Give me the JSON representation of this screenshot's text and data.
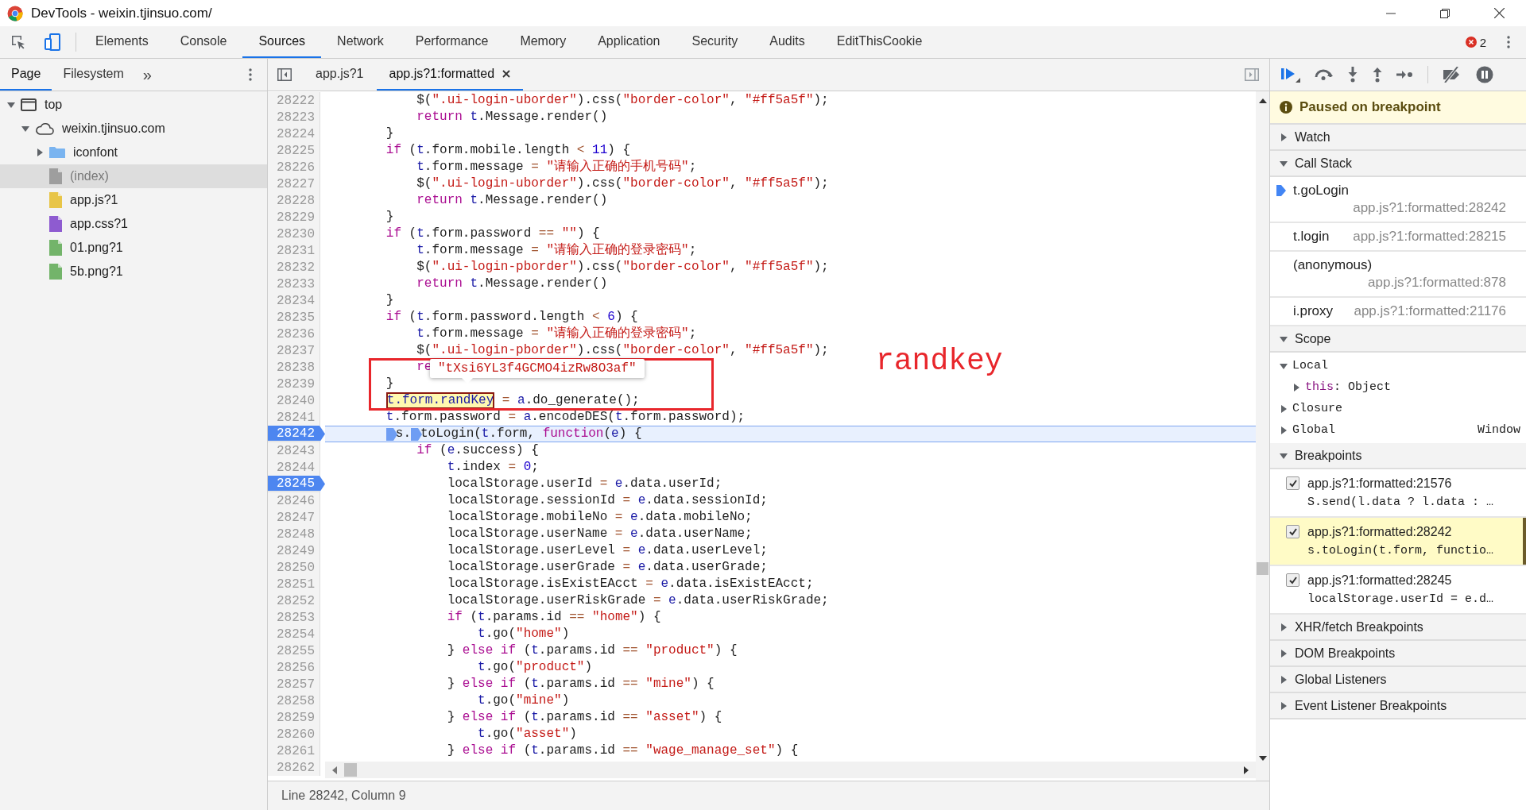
{
  "window": {
    "title": "DevTools - weixin.tjinsuo.com/"
  },
  "main_tabs": [
    {
      "label": "Elements",
      "selected": false
    },
    {
      "label": "Console",
      "selected": false
    },
    {
      "label": "Sources",
      "selected": true
    },
    {
      "label": "Network",
      "selected": false
    },
    {
      "label": "Performance",
      "selected": false
    },
    {
      "label": "Memory",
      "selected": false
    },
    {
      "label": "Application",
      "selected": false
    },
    {
      "label": "Security",
      "selected": false
    },
    {
      "label": "Audits",
      "selected": false
    },
    {
      "label": "EditThisCookie",
      "selected": false
    }
  ],
  "error_count": "2",
  "sidebar": {
    "tabs": [
      {
        "label": "Page",
        "selected": true
      },
      {
        "label": "Filesystem",
        "selected": false
      }
    ],
    "more": "»",
    "tree": [
      {
        "label": "top",
        "kind": "frame",
        "expanded": true,
        "selected": false,
        "children": [
          {
            "label": "weixin.tjinsuo.com",
            "kind": "domain",
            "expanded": true,
            "selected": false,
            "children": [
              {
                "label": "iconfont",
                "kind": "folder",
                "expanded": false,
                "selected": false
              },
              {
                "label": "(index)",
                "kind": "document",
                "selected": true
              },
              {
                "label": "app.js?1",
                "kind": "script",
                "selected": false
              },
              {
                "label": "app.css?1",
                "kind": "stylesheet",
                "selected": false
              },
              {
                "label": "01.png?1",
                "kind": "image",
                "selected": false
              },
              {
                "label": "5b.png?1",
                "kind": "image",
                "selected": false
              }
            ]
          }
        ]
      }
    ]
  },
  "editor": {
    "tabs": [
      {
        "label": "app.js?1",
        "selected": false,
        "closable": false
      },
      {
        "label": "app.js?1:formatted",
        "selected": true,
        "closable": true
      }
    ],
    "lines": [
      {
        "number": "28222",
        "breakpoint": false,
        "current": false,
        "tokens": [
          {
            "kind": "plain",
            "text": "            $("
          },
          {
            "kind": "string",
            "text": "\".ui-login-uborder\""
          },
          {
            "kind": "plain",
            "text": ").css("
          },
          {
            "kind": "string",
            "text": "\"border-color\""
          },
          {
            "kind": "plain",
            "text": ", "
          },
          {
            "kind": "string",
            "text": "\"#ff5a5f\""
          },
          {
            "kind": "plain",
            "text": ");"
          }
        ]
      },
      {
        "number": "28223",
        "breakpoint": false,
        "current": false,
        "tokens": [
          {
            "kind": "keyword",
            "text": "            return "
          },
          {
            "kind": "variable",
            "text": "t"
          },
          {
            "kind": "plain",
            "text": ".Message.render()"
          }
        ]
      },
      {
        "number": "28224",
        "breakpoint": false,
        "current": false,
        "tokens": [
          {
            "kind": "plain",
            "text": "        }"
          }
        ]
      },
      {
        "number": "28225",
        "breakpoint": false,
        "current": false,
        "tokens": [
          {
            "kind": "keyword",
            "text": "        if"
          },
          {
            "kind": "plain",
            "text": " ("
          },
          {
            "kind": "variable",
            "text": "t"
          },
          {
            "kind": "plain",
            "text": ".form.mobile.length "
          },
          {
            "kind": "operator",
            "text": "< "
          },
          {
            "kind": "number",
            "text": "11"
          },
          {
            "kind": "plain",
            "text": ") {"
          }
        ]
      },
      {
        "number": "28226",
        "breakpoint": false,
        "current": false,
        "tokens": [
          {
            "kind": "variable",
            "text": "            t"
          },
          {
            "kind": "plain",
            "text": ".form.message "
          },
          {
            "kind": "operator",
            "text": "= "
          },
          {
            "kind": "string",
            "text": "\"请输入正确的手机号码\""
          },
          {
            "kind": "plain",
            "text": ";"
          }
        ]
      },
      {
        "number": "28227",
        "breakpoint": false,
        "current": false,
        "tokens": [
          {
            "kind": "plain",
            "text": "            $("
          },
          {
            "kind": "string",
            "text": "\".ui-login-uborder\""
          },
          {
            "kind": "plain",
            "text": ").css("
          },
          {
            "kind": "string",
            "text": "\"border-color\""
          },
          {
            "kind": "plain",
            "text": ", "
          },
          {
            "kind": "string",
            "text": "\"#ff5a5f\""
          },
          {
            "kind": "plain",
            "text": ");"
          }
        ]
      },
      {
        "number": "28228",
        "breakpoint": false,
        "current": false,
        "tokens": [
          {
            "kind": "keyword",
            "text": "            return "
          },
          {
            "kind": "variable",
            "text": "t"
          },
          {
            "kind": "plain",
            "text": ".Message.render()"
          }
        ]
      },
      {
        "number": "28229",
        "breakpoint": false,
        "current": false,
        "tokens": [
          {
            "kind": "plain",
            "text": "        }"
          }
        ]
      },
      {
        "number": "28230",
        "breakpoint": false,
        "current": false,
        "tokens": [
          {
            "kind": "keyword",
            "text": "        if"
          },
          {
            "kind": "plain",
            "text": " ("
          },
          {
            "kind": "variable",
            "text": "t"
          },
          {
            "kind": "plain",
            "text": ".form.password "
          },
          {
            "kind": "operator",
            "text": "== "
          },
          {
            "kind": "string",
            "text": "\"\""
          },
          {
            "kind": "plain",
            "text": ") {"
          }
        ]
      },
      {
        "number": "28231",
        "breakpoint": false,
        "current": false,
        "tokens": [
          {
            "kind": "variable",
            "text": "            t"
          },
          {
            "kind": "plain",
            "text": ".form.message "
          },
          {
            "kind": "operator",
            "text": "= "
          },
          {
            "kind": "string",
            "text": "\"请输入正确的登录密码\""
          },
          {
            "kind": "plain",
            "text": ";"
          }
        ]
      },
      {
        "number": "28232",
        "breakpoint": false,
        "current": false,
        "tokens": [
          {
            "kind": "plain",
            "text": "            $("
          },
          {
            "kind": "string",
            "text": "\".ui-login-pborder\""
          },
          {
            "kind": "plain",
            "text": ").css("
          },
          {
            "kind": "string",
            "text": "\"border-color\""
          },
          {
            "kind": "plain",
            "text": ", "
          },
          {
            "kind": "string",
            "text": "\"#ff5a5f\""
          },
          {
            "kind": "plain",
            "text": ");"
          }
        ]
      },
      {
        "number": "28233",
        "breakpoint": false,
        "current": false,
        "tokens": [
          {
            "kind": "keyword",
            "text": "            return "
          },
          {
            "kind": "variable",
            "text": "t"
          },
          {
            "kind": "plain",
            "text": ".Message.render()"
          }
        ]
      },
      {
        "number": "28234",
        "breakpoint": false,
        "current": false,
        "tokens": [
          {
            "kind": "plain",
            "text": "        }"
          }
        ]
      },
      {
        "number": "28235",
        "breakpoint": false,
        "current": false,
        "tokens": [
          {
            "kind": "keyword",
            "text": "        if"
          },
          {
            "kind": "plain",
            "text": " ("
          },
          {
            "kind": "variable",
            "text": "t"
          },
          {
            "kind": "plain",
            "text": ".form.password.length "
          },
          {
            "kind": "operator",
            "text": "< "
          },
          {
            "kind": "number",
            "text": "6"
          },
          {
            "kind": "plain",
            "text": ") {"
          }
        ]
      },
      {
        "number": "28236",
        "breakpoint": false,
        "current": false,
        "tokens": [
          {
            "kind": "variable",
            "text": "            t"
          },
          {
            "kind": "plain",
            "text": ".form.message "
          },
          {
            "kind": "operator",
            "text": "= "
          },
          {
            "kind": "string",
            "text": "\"请输入正确的登录密码\""
          },
          {
            "kind": "plain",
            "text": ";"
          }
        ]
      },
      {
        "number": "28237",
        "breakpoint": false,
        "current": false,
        "tokens": [
          {
            "kind": "plain",
            "text": "            $("
          },
          {
            "kind": "string",
            "text": "\".ui-login-pborder\""
          },
          {
            "kind": "plain",
            "text": ").css("
          },
          {
            "kind": "string",
            "text": "\"border-color\""
          },
          {
            "kind": "plain",
            "text": ", "
          },
          {
            "kind": "string",
            "text": "\"#ff5a5f\""
          },
          {
            "kind": "plain",
            "text": ");"
          }
        ]
      },
      {
        "number": "28238",
        "breakpoint": false,
        "current": false,
        "tokens": [
          {
            "kind": "keyword",
            "text": "            re"
          }
        ]
      },
      {
        "number": "28239",
        "breakpoint": false,
        "current": false,
        "tokens": [
          {
            "kind": "plain",
            "text": "        }"
          }
        ]
      },
      {
        "number": "28240",
        "breakpoint": false,
        "current": false,
        "tokens": [
          {
            "kind": "hover",
            "text": "        t.form.randKey"
          },
          {
            "kind": "operator",
            "text": " = "
          },
          {
            "kind": "variable",
            "text": "a"
          },
          {
            "kind": "plain",
            "text": ".do_generate();"
          }
        ]
      },
      {
        "number": "28241",
        "breakpoint": false,
        "current": false,
        "tokens": [
          {
            "kind": "variable",
            "text": "        t"
          },
          {
            "kind": "plain",
            "text": ".form.password "
          },
          {
            "kind": "operator",
            "text": "= "
          },
          {
            "kind": "variable",
            "text": "a"
          },
          {
            "kind": "plain",
            "text": ".encodeDES("
          },
          {
            "kind": "variable",
            "text": "t"
          },
          {
            "kind": "plain",
            "text": ".form.password);"
          }
        ]
      },
      {
        "number": "28242",
        "breakpoint": true,
        "current": true,
        "tokens": [
          {
            "kind": "marker"
          },
          {
            "kind": "plain",
            "text": "        s."
          },
          {
            "kind": "marker"
          },
          {
            "kind": "plain",
            "text": "toLogin("
          },
          {
            "kind": "variable",
            "text": "t"
          },
          {
            "kind": "plain",
            "text": ".form, "
          },
          {
            "kind": "keyword",
            "text": "function"
          },
          {
            "kind": "plain",
            "text": "("
          },
          {
            "kind": "variable",
            "text": "e"
          },
          {
            "kind": "plain",
            "text": ") {"
          }
        ]
      },
      {
        "number": "28243",
        "breakpoint": false,
        "current": false,
        "tokens": [
          {
            "kind": "keyword",
            "text": "            if"
          },
          {
            "kind": "plain",
            "text": " ("
          },
          {
            "kind": "variable",
            "text": "e"
          },
          {
            "kind": "plain",
            "text": ".success) {"
          }
        ]
      },
      {
        "number": "28244",
        "breakpoint": false,
        "current": false,
        "tokens": [
          {
            "kind": "variable",
            "text": "                t"
          },
          {
            "kind": "plain",
            "text": ".index "
          },
          {
            "kind": "operator",
            "text": "= "
          },
          {
            "kind": "number",
            "text": "0"
          },
          {
            "kind": "plain",
            "text": ";"
          }
        ]
      },
      {
        "number": "28245",
        "breakpoint": true,
        "current": false,
        "tokens": [
          {
            "kind": "plain",
            "text": "                localStorage.userId "
          },
          {
            "kind": "operator",
            "text": "= "
          },
          {
            "kind": "variable",
            "text": "e"
          },
          {
            "kind": "plain",
            "text": ".data.userId;"
          }
        ]
      },
      {
        "number": "28246",
        "breakpoint": false,
        "current": false,
        "tokens": [
          {
            "kind": "plain",
            "text": "                localStorage.sessionId "
          },
          {
            "kind": "operator",
            "text": "= "
          },
          {
            "kind": "variable",
            "text": "e"
          },
          {
            "kind": "plain",
            "text": ".data.sessionId;"
          }
        ]
      },
      {
        "number": "28247",
        "breakpoint": false,
        "current": false,
        "tokens": [
          {
            "kind": "plain",
            "text": "                localStorage.mobileNo "
          },
          {
            "kind": "operator",
            "text": "= "
          },
          {
            "kind": "variable",
            "text": "e"
          },
          {
            "kind": "plain",
            "text": ".data.mobileNo;"
          }
        ]
      },
      {
        "number": "28248",
        "breakpoint": false,
        "current": false,
        "tokens": [
          {
            "kind": "plain",
            "text": "                localStorage.userName "
          },
          {
            "kind": "operator",
            "text": "= "
          },
          {
            "kind": "variable",
            "text": "e"
          },
          {
            "kind": "plain",
            "text": ".data.userName;"
          }
        ]
      },
      {
        "number": "28249",
        "breakpoint": false,
        "current": false,
        "tokens": [
          {
            "kind": "plain",
            "text": "                localStorage.userLevel "
          },
          {
            "kind": "operator",
            "text": "= "
          },
          {
            "kind": "variable",
            "text": "e"
          },
          {
            "kind": "plain",
            "text": ".data.userLevel;"
          }
        ]
      },
      {
        "number": "28250",
        "breakpoint": false,
        "current": false,
        "tokens": [
          {
            "kind": "plain",
            "text": "                localStorage.userGrade "
          },
          {
            "kind": "operator",
            "text": "= "
          },
          {
            "kind": "variable",
            "text": "e"
          },
          {
            "kind": "plain",
            "text": ".data.userGrade;"
          }
        ]
      },
      {
        "number": "28251",
        "breakpoint": false,
        "current": false,
        "tokens": [
          {
            "kind": "plain",
            "text": "                localStorage.isExistEAcct "
          },
          {
            "kind": "operator",
            "text": "= "
          },
          {
            "kind": "variable",
            "text": "e"
          },
          {
            "kind": "plain",
            "text": ".data.isExistEAcct;"
          }
        ]
      },
      {
        "number": "28252",
        "breakpoint": false,
        "current": false,
        "tokens": [
          {
            "kind": "plain",
            "text": "                localStorage.userRiskGrade "
          },
          {
            "kind": "operator",
            "text": "= "
          },
          {
            "kind": "variable",
            "text": "e"
          },
          {
            "kind": "plain",
            "text": ".data.userRiskGrade;"
          }
        ]
      },
      {
        "number": "28253",
        "breakpoint": false,
        "current": false,
        "tokens": [
          {
            "kind": "keyword",
            "text": "                if"
          },
          {
            "kind": "plain",
            "text": " ("
          },
          {
            "kind": "variable",
            "text": "t"
          },
          {
            "kind": "plain",
            "text": ".params.id "
          },
          {
            "kind": "operator",
            "text": "== "
          },
          {
            "kind": "string",
            "text": "\"home\""
          },
          {
            "kind": "plain",
            "text": ") {"
          }
        ]
      },
      {
        "number": "28254",
        "breakpoint": false,
        "current": false,
        "tokens": [
          {
            "kind": "variable",
            "text": "                    t"
          },
          {
            "kind": "plain",
            "text": ".go("
          },
          {
            "kind": "string",
            "text": "\"home\""
          },
          {
            "kind": "plain",
            "text": ")"
          }
        ]
      },
      {
        "number": "28255",
        "breakpoint": false,
        "current": false,
        "tokens": [
          {
            "kind": "plain",
            "text": "                } "
          },
          {
            "kind": "keyword",
            "text": "else if"
          },
          {
            "kind": "plain",
            "text": " ("
          },
          {
            "kind": "variable",
            "text": "t"
          },
          {
            "kind": "plain",
            "text": ".params.id "
          },
          {
            "kind": "operator",
            "text": "== "
          },
          {
            "kind": "string",
            "text": "\"product\""
          },
          {
            "kind": "plain",
            "text": ") {"
          }
        ]
      },
      {
        "number": "28256",
        "breakpoint": false,
        "current": false,
        "tokens": [
          {
            "kind": "variable",
            "text": "                    t"
          },
          {
            "kind": "plain",
            "text": ".go("
          },
          {
            "kind": "string",
            "text": "\"product\""
          },
          {
            "kind": "plain",
            "text": ")"
          }
        ]
      },
      {
        "number": "28257",
        "breakpoint": false,
        "current": false,
        "tokens": [
          {
            "kind": "plain",
            "text": "                } "
          },
          {
            "kind": "keyword",
            "text": "else if"
          },
          {
            "kind": "plain",
            "text": " ("
          },
          {
            "kind": "variable",
            "text": "t"
          },
          {
            "kind": "plain",
            "text": ".params.id "
          },
          {
            "kind": "operator",
            "text": "== "
          },
          {
            "kind": "string",
            "text": "\"mine\""
          },
          {
            "kind": "plain",
            "text": ") {"
          }
        ]
      },
      {
        "number": "28258",
        "breakpoint": false,
        "current": false,
        "tokens": [
          {
            "kind": "variable",
            "text": "                    t"
          },
          {
            "kind": "plain",
            "text": ".go("
          },
          {
            "kind": "string",
            "text": "\"mine\""
          },
          {
            "kind": "plain",
            "text": ")"
          }
        ]
      },
      {
        "number": "28259",
        "breakpoint": false,
        "current": false,
        "tokens": [
          {
            "kind": "plain",
            "text": "                } "
          },
          {
            "kind": "keyword",
            "text": "else if"
          },
          {
            "kind": "plain",
            "text": " ("
          },
          {
            "kind": "variable",
            "text": "t"
          },
          {
            "kind": "plain",
            "text": ".params.id "
          },
          {
            "kind": "operator",
            "text": "== "
          },
          {
            "kind": "string",
            "text": "\"asset\""
          },
          {
            "kind": "plain",
            "text": ") {"
          }
        ]
      },
      {
        "number": "28260",
        "breakpoint": false,
        "current": false,
        "tokens": [
          {
            "kind": "variable",
            "text": "                    t"
          },
          {
            "kind": "plain",
            "text": ".go("
          },
          {
            "kind": "string",
            "text": "\"asset\""
          },
          {
            "kind": "plain",
            "text": ")"
          }
        ]
      },
      {
        "number": "28261",
        "breakpoint": false,
        "current": false,
        "tokens": [
          {
            "kind": "plain",
            "text": "                } "
          },
          {
            "kind": "keyword",
            "text": "else if"
          },
          {
            "kind": "plain",
            "text": " ("
          },
          {
            "kind": "variable",
            "text": "t"
          },
          {
            "kind": "plain",
            "text": ".params.id "
          },
          {
            "kind": "operator",
            "text": "== "
          },
          {
            "kind": "string",
            "text": "\"wage_manage_set\""
          },
          {
            "kind": "plain",
            "text": ") {"
          }
        ]
      },
      {
        "number": "28262",
        "breakpoint": false,
        "current": false
      }
    ],
    "value_popover": {
      "text": "\"tXsi6YL3f4GCMO4izRw8O3af\""
    },
    "annotation": {
      "text": "randkey"
    },
    "status_bar": "Line 28242, Column 9"
  },
  "debugger": {
    "paused_banner": "Paused on breakpoint",
    "sections": [
      {
        "kind": "watch",
        "title": "Watch",
        "expanded": false
      },
      {
        "kind": "call_stack",
        "title": "Call Stack",
        "expanded": true,
        "frames": [
          {
            "name": "t.goLogin",
            "location": "app.js?1:formatted:28242",
            "selected": true
          },
          {
            "name": "t.login",
            "location": "app.js?1:formatted:28215",
            "selected": false
          },
          {
            "name": "(anonymous)",
            "location": "app.js?1:formatted:878",
            "selected": false
          },
          {
            "name": "i.proxy",
            "location": "app.js?1:formatted:21176",
            "selected": false
          }
        ]
      },
      {
        "kind": "scope",
        "title": "Scope",
        "expanded": true,
        "items": [
          {
            "name": "Local",
            "expanded": true,
            "children": [
              {
                "name": "this",
                "rest": ": Object",
                "expanded": false
              }
            ]
          },
          {
            "name": "Closure",
            "expanded": false
          },
          {
            "name": "Global",
            "expanded": false,
            "value": "Window"
          }
        ]
      },
      {
        "kind": "breakpoints",
        "title": "Breakpoints",
        "expanded": true,
        "items": [
          {
            "location": "app.js?1:formatted:21576",
            "code": "S.send(l.data ? l.data : …",
            "checked": true,
            "selected": false
          },
          {
            "location": "app.js?1:formatted:28242",
            "code": "s.toLogin(t.form, functio…",
            "checked": true,
            "selected": true
          },
          {
            "location": "app.js?1:formatted:28245",
            "code": "localStorage.userId = e.d…",
            "checked": true,
            "selected": false
          }
        ]
      },
      {
        "kind": "xhr",
        "title": "XHR/fetch Breakpoints",
        "expanded": false
      },
      {
        "kind": "dom",
        "title": "DOM Breakpoints",
        "expanded": false
      },
      {
        "kind": "listeners",
        "title": "Global Listeners",
        "expanded": false
      },
      {
        "kind": "events",
        "title": "Event Listener Breakpoints",
        "expanded": false
      }
    ]
  }
}
